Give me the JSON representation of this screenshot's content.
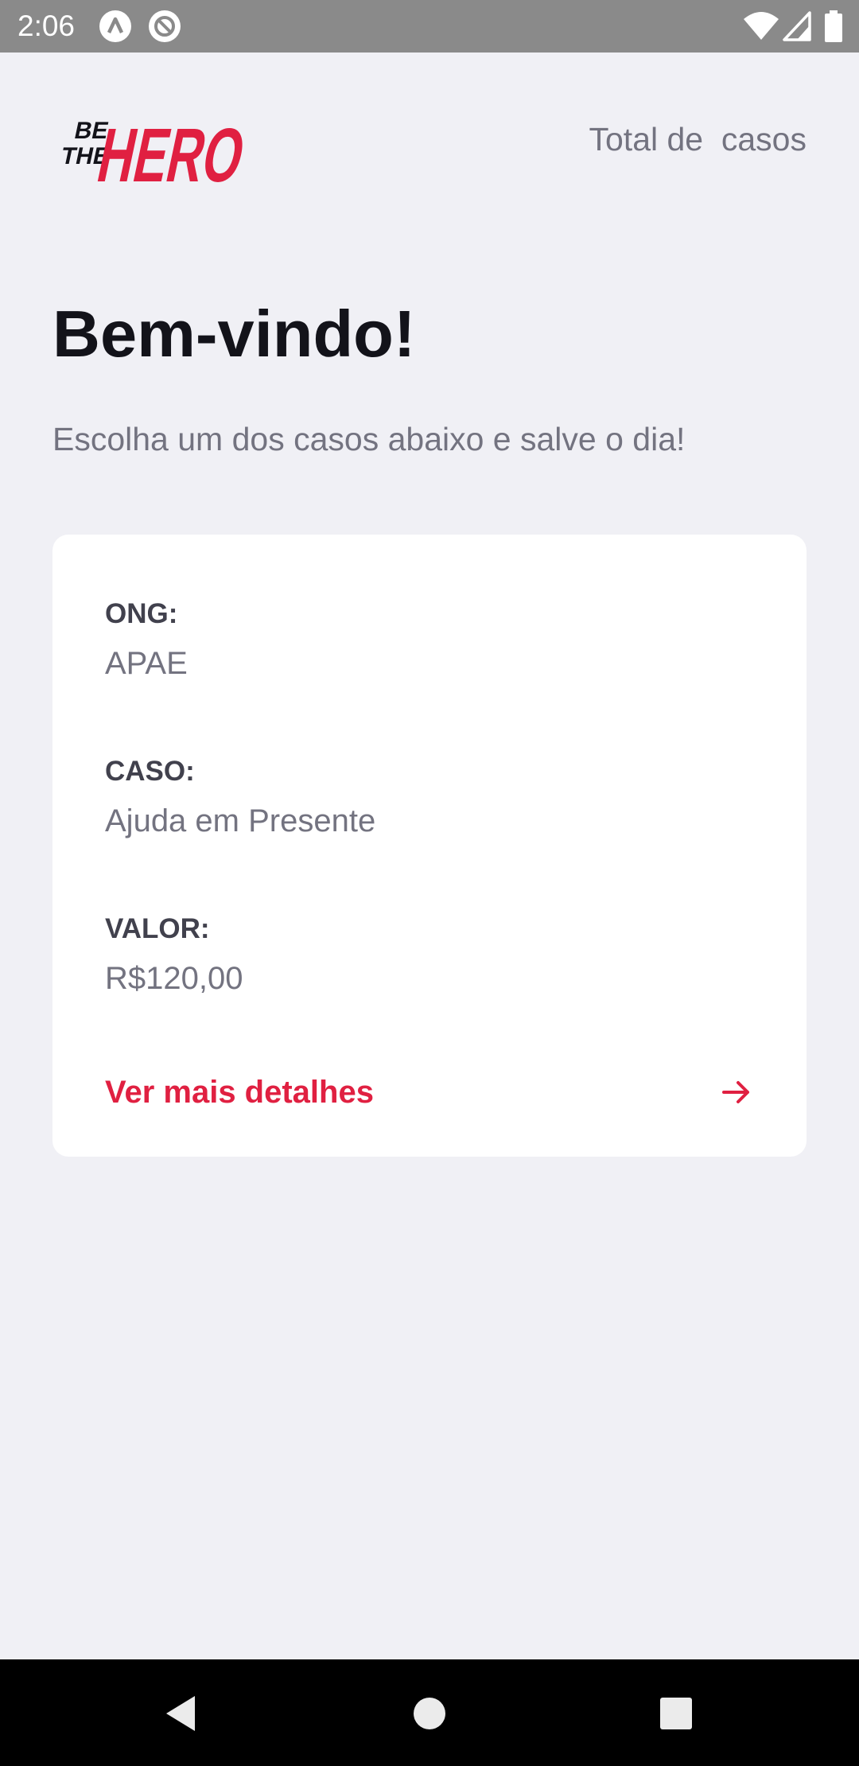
{
  "status_bar": {
    "time": "2:06",
    "icons": [
      "notification-a-icon",
      "notification-at-icon",
      "wifi-icon",
      "signal-icon",
      "battery-icon"
    ]
  },
  "header": {
    "logo_line1": "BE",
    "logo_line2": "THE",
    "logo_word": "HERO",
    "total_casos": "Total de  casos"
  },
  "main": {
    "title": "Bem-vindo!",
    "description": "Escolha um dos casos abaixo e salve o dia!"
  },
  "incident": {
    "ong_label": "ONG:",
    "ong_value": "APAE",
    "caso_label": "CASO:",
    "caso_value": "Ajuda em Presente",
    "valor_label": "VALOR:",
    "valor_value": "R$120,00",
    "details_label": "Ver mais detalhes",
    "details_icon": "arrow-right-icon"
  },
  "nav_bar": {
    "buttons": [
      "back-icon",
      "home-icon",
      "recents-icon"
    ]
  },
  "colors": {
    "accent": "#e02041",
    "background": "#f0f0f5",
    "card": "#ffffff",
    "title": "#13131a",
    "muted": "#737380",
    "label": "#41414d"
  }
}
